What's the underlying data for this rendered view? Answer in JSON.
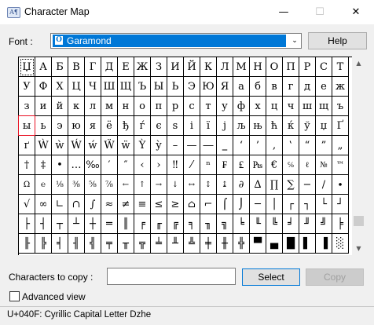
{
  "window": {
    "title": "Character Map",
    "icon": "character-map-app-icon",
    "icon_glyph": "A¶"
  },
  "title_buttons": {
    "minimize": "—",
    "maximize": "☐",
    "close": "✕"
  },
  "font_picker": {
    "label": "Font :",
    "value": "Garamond",
    "type_icon": "opentype-font-icon",
    "type_glyph": "O",
    "dropdown_icon": "chevron-down-icon",
    "dropdown_glyph": "⌄"
  },
  "help_button": "Help",
  "selected_char": {
    "row": 0,
    "col": 0
  },
  "highlighted_char": {
    "row": 3,
    "col": 0
  },
  "grid": {
    "rows": [
      [
        "Џ",
        "А",
        "Б",
        "В",
        "Г",
        "Д",
        "Е",
        "Ж",
        "З",
        "И",
        "Й",
        "К",
        "Л",
        "М",
        "Н",
        "О",
        "П",
        "Р",
        "С",
        "Т"
      ],
      [
        "У",
        "Ф",
        "Х",
        "Ц",
        "Ч",
        "Ш",
        "Щ",
        "Ъ",
        "Ы",
        "Ь",
        "Э",
        "Ю",
        "Я",
        "а",
        "б",
        "в",
        "г",
        "д",
        "е",
        "ж"
      ],
      [
        "з",
        "и",
        "й",
        "к",
        "л",
        "м",
        "н",
        "о",
        "п",
        "р",
        "с",
        "т",
        "у",
        "ф",
        "х",
        "ц",
        "ч",
        "ш",
        "щ",
        "ъ"
      ],
      [
        "ы",
        "ь",
        "э",
        "ю",
        "я",
        "ё",
        "ђ",
        "ѓ",
        "є",
        "ѕ",
        "і",
        "ї",
        "ј",
        "љ",
        "њ",
        "ћ",
        "ќ",
        "ў",
        "џ",
        "Ґ"
      ],
      [
        "ґ",
        "Ẁ",
        "ẁ",
        "Ẃ",
        "ẃ",
        "Ẅ",
        "ẅ",
        "Ỳ",
        "ỳ",
        "–",
        "—",
        "―",
        "‗",
        "‘",
        "’",
        "‚",
        "‛",
        "“",
        "”",
        "„"
      ],
      [
        "†",
        "‡",
        "•",
        "…",
        "‰",
        "′",
        "″",
        "‹",
        "›",
        "‼",
        "⁄",
        "ⁿ",
        "₣",
        "₤",
        "₧",
        "€",
        "℅",
        "ℓ",
        "№",
        "™"
      ],
      [
        "Ω",
        "℮",
        "⅛",
        "⅜",
        "⅝",
        "⅞",
        "←",
        "↑",
        "→",
        "↓",
        "↔",
        "↕",
        "↨",
        "∂",
        "∆",
        "∏",
        "∑",
        "−",
        "∕",
        "∙"
      ],
      [
        "√",
        "∞",
        "∟",
        "∩",
        "∫",
        "≈",
        "≠",
        "≡",
        "≤",
        "≥",
        "⌂",
        "⌐",
        "⌠",
        "⌡",
        "─",
        "│",
        "┌",
        "┐",
        "└",
        "┘"
      ],
      [
        "├",
        "┤",
        "┬",
        "┴",
        "┼",
        "═",
        "║",
        "╒",
        "╓",
        "╔",
        "╕",
        "╖",
        "╗",
        "╘",
        "╙",
        "╚",
        "╛",
        "╜",
        "╝",
        "╞"
      ],
      [
        "╟",
        "╠",
        "╡",
        "╢",
        "╣",
        "╤",
        "╥",
        "╦",
        "╧",
        "╨",
        "╩",
        "╪",
        "╫",
        "╬",
        "▀",
        "▄",
        "█",
        "▌",
        "▐",
        "░"
      ]
    ]
  },
  "scrollbar": {
    "up_glyph": "▲",
    "down_glyph": "▼"
  },
  "copy": {
    "label": "Characters to copy :",
    "value": "",
    "select_label": "Select",
    "copy_label": "Copy"
  },
  "advanced_view": {
    "label": "Advanced view",
    "checked": false
  },
  "status": "U+040F: Cyrillic Capital Letter Dzhe"
}
